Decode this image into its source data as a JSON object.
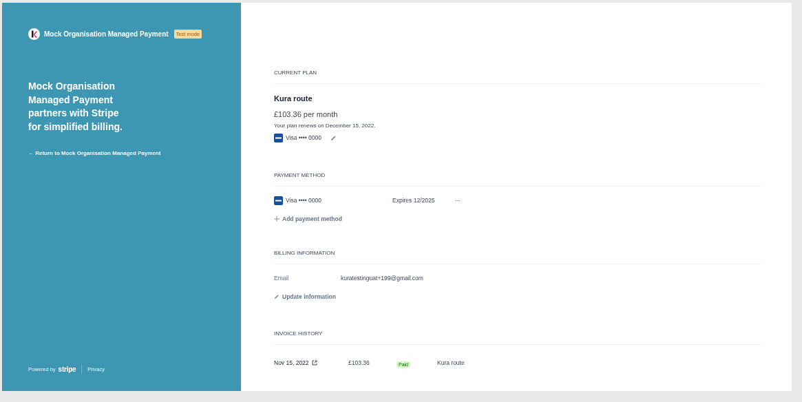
{
  "sidebar": {
    "business_name": "Mock Organisation Managed Payment",
    "badge": "Test mode",
    "headline": "Mock Organisation Managed Payment partners with Stripe for simplified billing.",
    "return_link": "← Return to Mock Organisation Managed Payment",
    "footer": {
      "powered_by": "Powered by",
      "brand": "stripe",
      "privacy": "Privacy"
    }
  },
  "current_plan": {
    "heading": "CURRENT PLAN",
    "plan_name": "Kura route",
    "price": "£103.36 per month",
    "renewal": "Your plan renews on December 15, 2022.",
    "card": "Visa •••• 0000"
  },
  "payment_method": {
    "heading": "PAYMENT METHOD",
    "cards": [
      {
        "label": "Visa •••• 0000",
        "expiry": "Expires 12/2025",
        "menu": "···"
      }
    ],
    "add": "Add payment method"
  },
  "billing_information": {
    "heading": "BILLING INFORMATION",
    "fields": [
      {
        "label": "Email",
        "value": "kuratestinguat+199@gmail.com"
      }
    ],
    "update": "Update information"
  },
  "invoice_history": {
    "heading": "INVOICE HISTORY",
    "rows": [
      {
        "date": "Nov 15, 2022",
        "amount": "£103.36",
        "status": "Paid",
        "plan": "Kura route"
      }
    ]
  }
}
